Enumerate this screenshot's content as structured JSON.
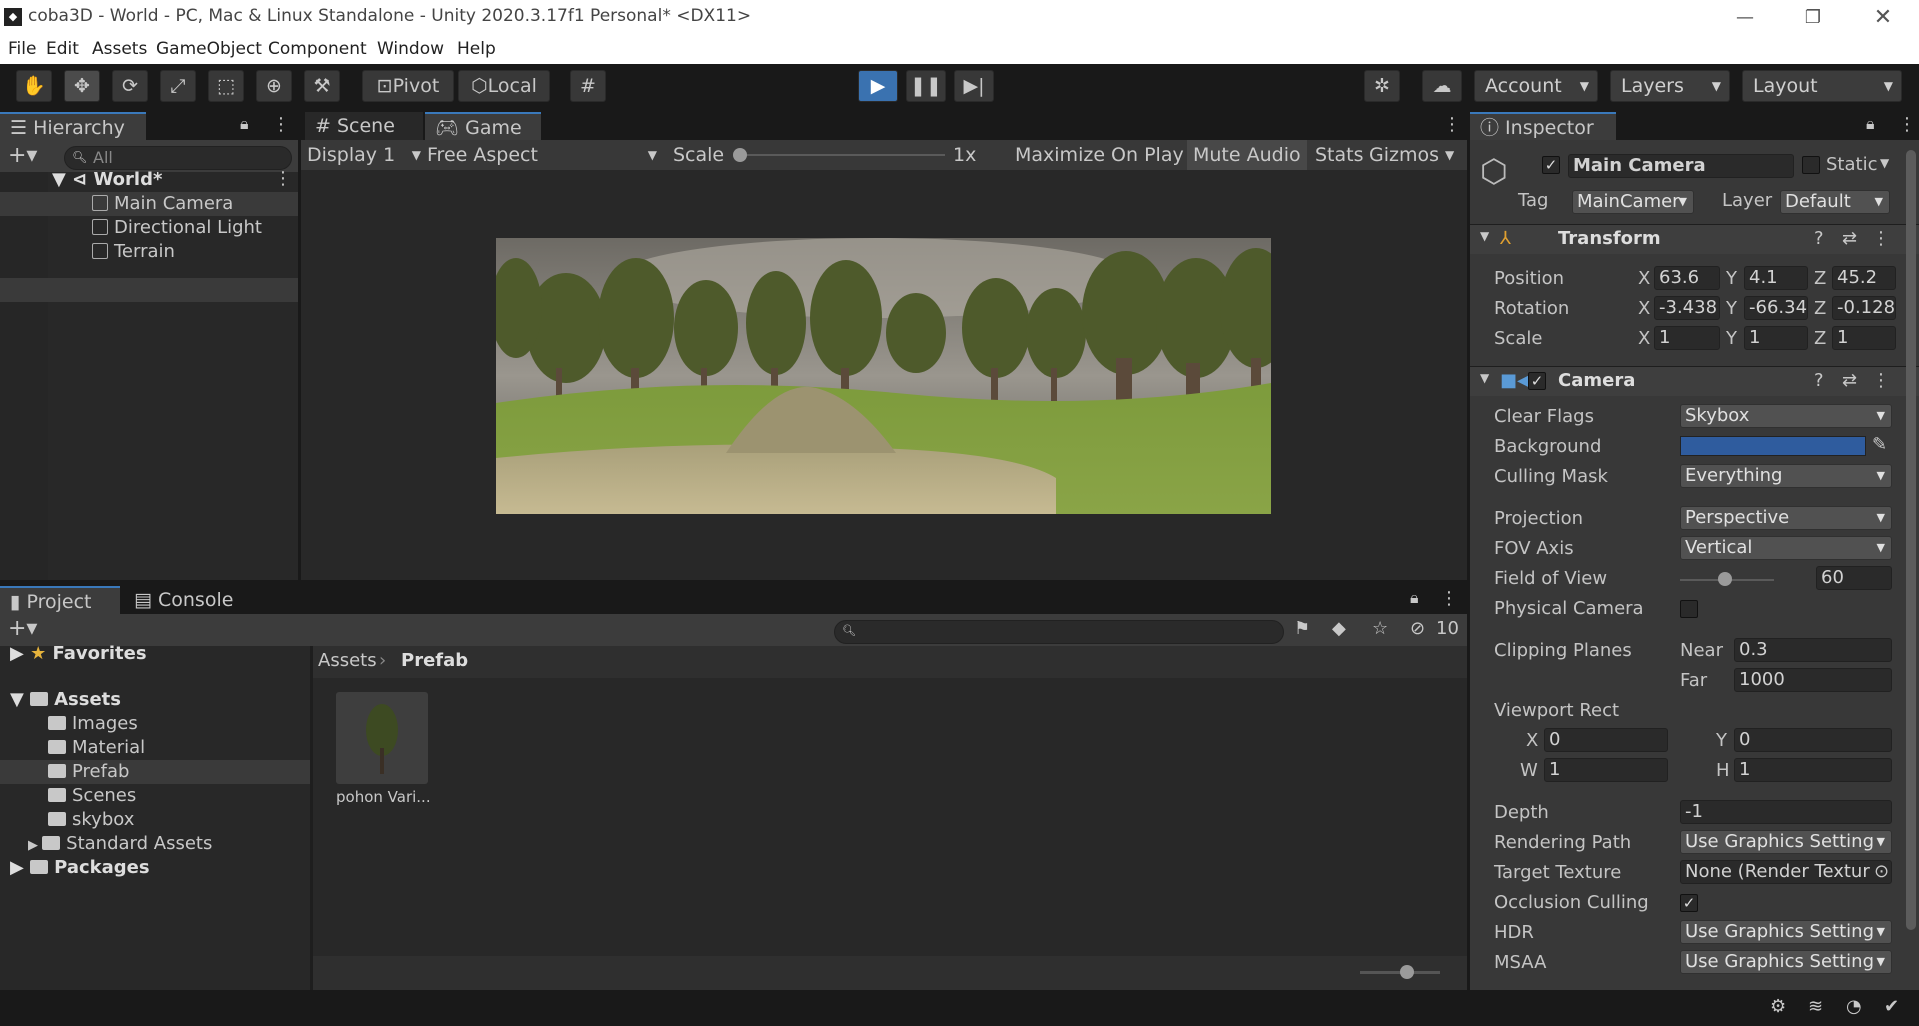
{
  "window": {
    "title": "coba3D - World - PC, Mac & Linux Standalone - Unity 2020.3.17f1 Personal* <DX11>",
    "app_icon": "unity-icon"
  },
  "menu": [
    "File",
    "Edit",
    "Assets",
    "GameObject",
    "Component",
    "Window",
    "Help"
  ],
  "toolbar": {
    "pivot": "Pivot",
    "local": "Local",
    "account": "Account",
    "layers": "Layers",
    "layout": "Layout"
  },
  "hierarchy": {
    "tab": "Hierarchy",
    "search_placeholder": "All",
    "scene": "World*",
    "items": [
      "Main Camera",
      "Directional Light",
      "Terrain"
    ]
  },
  "scene_tabs": {
    "scene": "Scene",
    "game": "Game"
  },
  "game_bar": {
    "display": "Display 1",
    "aspect": "Free Aspect",
    "scale_label": "Scale",
    "scale_value": "1x",
    "maximize": "Maximize On Play",
    "mute": "Mute Audio",
    "stats": "Stats",
    "gizmos": "Gizmos"
  },
  "project": {
    "tab": "Project",
    "console_tab": "Console",
    "favorites": "Favorites",
    "assets": "Assets",
    "folders": [
      "Images",
      "Material",
      "Prefab",
      "Scenes",
      "skybox",
      "Standard Assets"
    ],
    "packages": "Packages",
    "breadcrumb_root": "Assets",
    "breadcrumb_current": "Prefab",
    "hidden_count": "10",
    "asset_item": "pohon Vari..."
  },
  "inspector": {
    "tab": "Inspector",
    "object_name": "Main Camera",
    "static": "Static",
    "tag_label": "Tag",
    "tag": "MainCamer",
    "layer_label": "Layer",
    "layer": "Default",
    "transform": {
      "title": "Transform",
      "position_label": "Position",
      "rotation_label": "Rotation",
      "scale_label": "Scale",
      "position": {
        "x": "63.6",
        "y": "4.1",
        "z": "45.2"
      },
      "rotation": {
        "x": "-3.438",
        "y": "-66.34",
        "z": "-0.128"
      },
      "scale": {
        "x": "1",
        "y": "1",
        "z": "1"
      }
    },
    "camera": {
      "title": "Camera",
      "clear_flags_label": "Clear Flags",
      "clear_flags": "Skybox",
      "background_label": "Background",
      "background_color": "#2f5c9e",
      "culling_mask_label": "Culling Mask",
      "culling_mask": "Everything",
      "projection_label": "Projection",
      "projection": "Perspective",
      "fov_axis_label": "FOV Axis",
      "fov_axis": "Vertical",
      "fov_label": "Field of View",
      "fov": "60",
      "physical_label": "Physical Camera",
      "clipping_label": "Clipping Planes",
      "near_label": "Near",
      "near": "0.3",
      "far_label": "Far",
      "far": "1000",
      "viewport_label": "Viewport Rect",
      "vx": "0",
      "vy": "0",
      "vw": "1",
      "vh": "1",
      "depth_label": "Depth",
      "depth": "-1",
      "rendering_path_label": "Rendering Path",
      "rendering_path": "Use Graphics Setting",
      "target_texture_label": "Target Texture",
      "target_texture": "None (Render Textur",
      "occlusion_label": "Occlusion Culling",
      "hdr_label": "HDR",
      "hdr": "Use Graphics Setting",
      "msaa_label": "MSAA",
      "msaa": "Use Graphics Setting"
    }
  },
  "axis": {
    "x": "X",
    "y": "Y",
    "z": "Z",
    "w": "W",
    "h": "H"
  },
  "colors": {
    "accent": "#3a79bb",
    "play": "#3a72b0"
  }
}
